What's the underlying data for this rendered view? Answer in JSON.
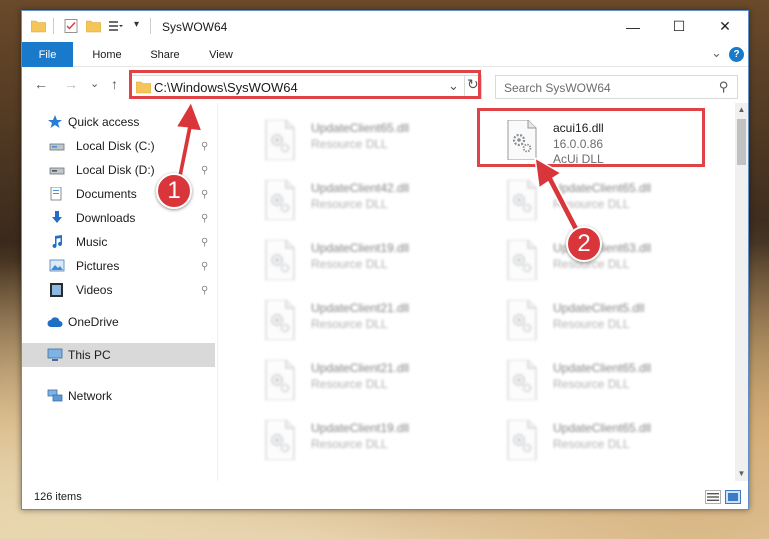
{
  "window": {
    "title": "SysWOW64",
    "controls": {
      "minimize": "—",
      "maximize": "☐",
      "close": "✕"
    }
  },
  "ribbon": {
    "tabs": [
      {
        "label": "File",
        "active": true
      },
      {
        "label": "Home"
      },
      {
        "label": "Share"
      },
      {
        "label": "View"
      }
    ],
    "expand_glyph": "⌄",
    "help_glyph": "?"
  },
  "address": {
    "path": "C:\\Windows\\SysWOW64",
    "dropdown_glyph": "⌄",
    "refresh_glyph": "↻"
  },
  "search": {
    "placeholder": "Search SysWOW64",
    "icon_glyph": "⚲"
  },
  "nav": {
    "back_glyph": "←",
    "forward_glyph": "→",
    "recent_glyph": "⌄",
    "up_glyph": "↑",
    "items": [
      {
        "label": "Quick access",
        "icon": "star-icon",
        "pinned": false
      },
      {
        "label": "Local Disk (C:)",
        "icon": "drive-icon",
        "pinned": true
      },
      {
        "label": "Local Disk (D:)",
        "icon": "drive-icon",
        "pinned": true
      },
      {
        "label": "Documents",
        "icon": "documents-icon",
        "pinned": true
      },
      {
        "label": "Downloads",
        "icon": "downloads-icon",
        "pinned": true
      },
      {
        "label": "Music",
        "icon": "music-icon",
        "pinned": true
      },
      {
        "label": "Pictures",
        "icon": "pictures-icon",
        "pinned": true
      },
      {
        "label": "Videos",
        "icon": "videos-icon",
        "pinned": true
      },
      {
        "label": "OneDrive",
        "icon": "cloud-icon",
        "pinned": false
      },
      {
        "label": "This PC",
        "icon": "computer-icon",
        "pinned": false,
        "selected": true
      },
      {
        "label": "Network",
        "icon": "network-icon",
        "pinned": false
      }
    ],
    "pin_glyph": "📌"
  },
  "files": {
    "highlighted": {
      "name": "acui16.dll",
      "version": "16.0.0.86",
      "type": "AcUi DLL"
    },
    "left_column": [
      {
        "name": "UpdateClient65.dll",
        "type": "Resource DLL"
      },
      {
        "name": "UpdateClient42.dll",
        "type": "Resource DLL"
      },
      {
        "name": "UpdateClient19.dll",
        "type": "Resource DLL"
      },
      {
        "name": "UpdateClient21.dll",
        "type": "Resource DLL"
      },
      {
        "name": "UpdateClient21.dll",
        "type": "Resource DLL"
      },
      {
        "name": "UpdateClient19.dll",
        "type": "Resource DLL"
      }
    ],
    "right_column": [
      {
        "name": "UpdateClient65.dll",
        "type": "Resource DLL"
      },
      {
        "name": "UpdateClient63.dll",
        "type": "Resource DLL"
      },
      {
        "name": "UpdateClient5.dll",
        "type": "Resource DLL"
      },
      {
        "name": "UpdateClient65.dll",
        "type": "Resource DLL"
      },
      {
        "name": "UpdateClient65.dll",
        "type": "Resource DLL"
      }
    ]
  },
  "status": {
    "item_count": "126 items"
  },
  "annotations": {
    "step1": "1",
    "step2": "2",
    "color": "#d9363b"
  },
  "colors": {
    "file_tab": "#1979ca",
    "highlight": "#e04345",
    "selected_nav": "#d9d9d9"
  }
}
